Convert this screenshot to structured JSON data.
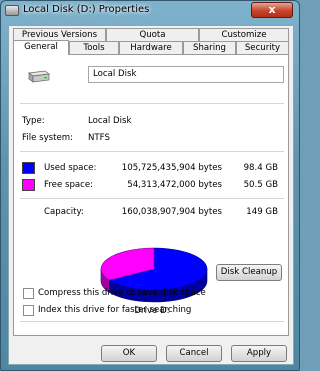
{
  "window": {
    "title": "Local Disk (D:) Properties",
    "close_glyph": "x"
  },
  "tabs_top": [
    "Previous Versions",
    "Quota",
    "Customize"
  ],
  "tabs_bottom": [
    "General",
    "Tools",
    "Hardware",
    "Sharing",
    "Security"
  ],
  "selected_tab": "General",
  "general": {
    "name_value": "Local Disk",
    "type_label": "Type:",
    "type_value": "Local Disk",
    "fs_label": "File system:",
    "fs_value": "NTFS",
    "used_label": "Used space:",
    "used_bytes": "105,725,435,904 bytes",
    "used_gb": "98.4 GB",
    "free_label": "Free space:",
    "free_bytes": "54,313,472,000 bytes",
    "free_gb": "50.5 GB",
    "capacity_label": "Capacity:",
    "capacity_bytes": "160,038,907,904 bytes",
    "capacity_gb": "149 GB",
    "drive_label": "Drive D:",
    "cleanup_button": "Disk Cleanup",
    "compress_label": "Compress this drive to save disk space",
    "index_label": "Index this drive for faster searching"
  },
  "colors": {
    "used": "#0000ff",
    "free": "#ff00ff"
  },
  "pie": {
    "used_fraction": 0.661,
    "free_fraction": 0.339
  },
  "footer": {
    "ok": "OK",
    "cancel": "Cancel",
    "apply": "Apply"
  }
}
